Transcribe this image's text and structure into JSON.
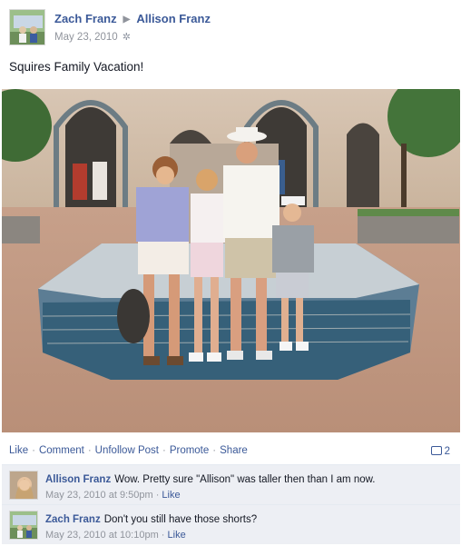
{
  "post": {
    "author": "Zach Franz",
    "target": "Allison Franz",
    "date": "May 23, 2010",
    "status": "Squires Family Vacation!"
  },
  "actions": {
    "like": "Like",
    "comment": "Comment",
    "unfollow": "Unfollow Post",
    "promote": "Promote",
    "share": "Share",
    "separator": "·",
    "comment_count": "2"
  },
  "comments": [
    {
      "author": "Allison Franz",
      "text": "Wow. Pretty sure \"Allison\" was taller then than I am now.",
      "timestamp": "May 23, 2010 at 9:50pm",
      "like": "Like"
    },
    {
      "author": "Zach Franz",
      "text": "Don't you still have those shorts?",
      "timestamp": "May 23, 2010 at 10:10pm",
      "like": "Like"
    }
  ],
  "icons": {
    "privacy": "gear-icon",
    "comments": "comment-bubble-icon",
    "arrow": "right-arrow-icon"
  },
  "colors": {
    "link": "#3b5998",
    "meta": "#90949c",
    "comment_bg": "#edeff4"
  }
}
